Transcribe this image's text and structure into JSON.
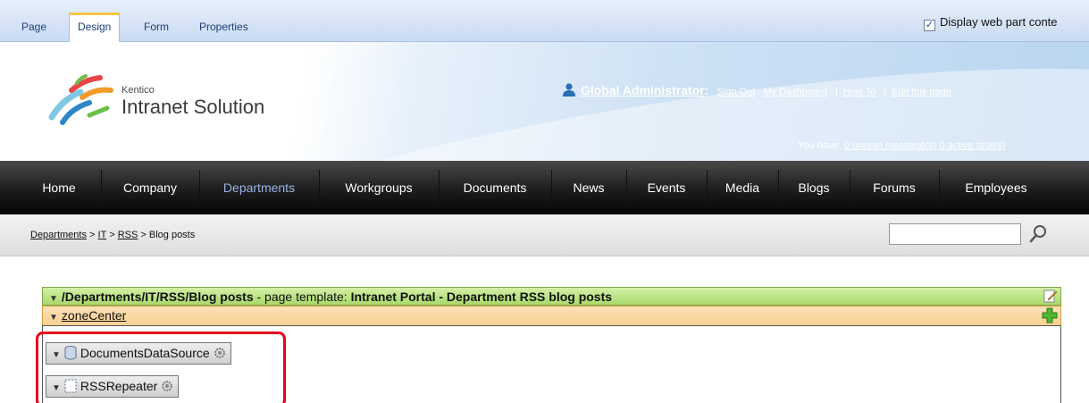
{
  "mode_tabs": [
    "Page",
    "Design",
    "Form",
    "Properties"
  ],
  "display_option": "Display web part conte",
  "brand": {
    "small": "Kentico",
    "big": "Intranet Solution"
  },
  "user": {
    "name": "Global Administrator",
    "colon": ":",
    "links": [
      "Sign Out",
      "My Dashboard",
      "How To",
      "Edit this page"
    ]
  },
  "messages": {
    "prefix": "You have:",
    "unread": "0 unread message(s)",
    "tasks": "0 active task(s)"
  },
  "nav": {
    "items": [
      "Home",
      "Company",
      "Departments",
      "Workgroups",
      "Documents",
      "News",
      "Events",
      "Media",
      "Blogs",
      "Forums",
      "Employees"
    ],
    "active": "Departments"
  },
  "breadcrumb": {
    "items": [
      "Departments",
      "IT",
      "RSS"
    ],
    "current": "Blog posts",
    "separator": ">"
  },
  "search": {
    "value": ""
  },
  "template": {
    "path": "/Departments/IT/RSS/Blog posts",
    "mid": " - page template: ",
    "name": "Intranet Portal - Department RSS blog posts"
  },
  "zone": {
    "name": "zoneCenter"
  },
  "webparts": [
    "DocumentsDataSource",
    "RSSRepeater"
  ],
  "colors": {
    "highlight": "#e8001c",
    "nav_active": "#9ab3e4",
    "template_bar": "#a9d96a",
    "zone_bar": "#f8c57a"
  }
}
